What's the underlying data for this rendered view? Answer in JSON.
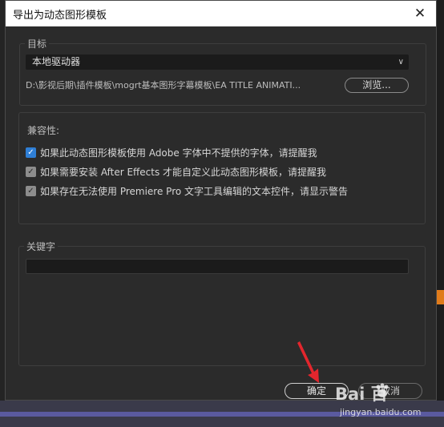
{
  "dialog": {
    "title": "导出为动态图形模板",
    "close_icon": "close-icon"
  },
  "destination": {
    "group_label": "目标",
    "drive_select": {
      "selected": "本地驱动器"
    },
    "path": "D:\\影视后期\\插件模板\\mogrt基本图形字幕模板\\EA TITLE ANIMATI...",
    "browse_label": "浏览..."
  },
  "compatibility": {
    "title": "兼容性:",
    "options": [
      {
        "label": "如果此动态图形模板使用 Adobe 字体中不提供的字体，请提醒我",
        "checked": true
      },
      {
        "label": "如果需要安装 After Effects 才能自定义此动态图形模板，请提醒我",
        "checked": true
      },
      {
        "label": "如果存在无法使用 Premiere Pro 文字工具编辑的文本控件，请显示警告",
        "checked": true
      }
    ]
  },
  "keywords": {
    "group_label": "关键字",
    "value": ""
  },
  "buttons": {
    "ok_label": "确定",
    "cancel_label": "取消"
  },
  "watermark": {
    "brand": "Bai  百",
    "site": "jingyan.baidu.com"
  },
  "colors": {
    "accent": "#2f7fd6",
    "arrow": "#e3262d"
  }
}
